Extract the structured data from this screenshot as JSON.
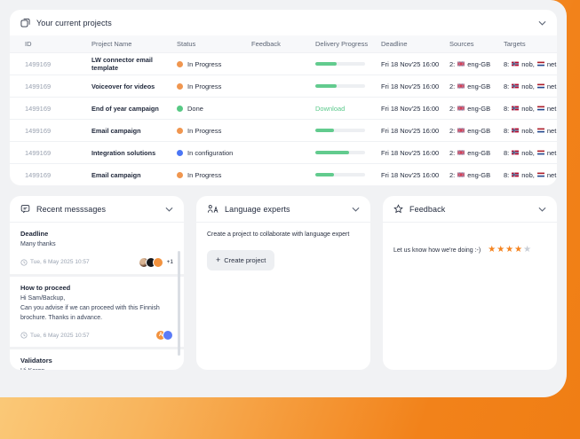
{
  "colors": {
    "accent_orange": "#F2821A",
    "status_in_progress": "#F0964F",
    "status_done": "#57C984",
    "status_in_configuration": "#4B76F5",
    "progress_fill": "#62CB8E",
    "download_link": "#5BC98B",
    "star_filled": "#F5831F",
    "star_empty": "#C9CED6"
  },
  "icons": {
    "projects-icon": "layered-squares",
    "messages-icon": "chat-bubble",
    "experts-icon": "person-with-letter-a",
    "feedback-icon": "star-outline",
    "chevron-down-icon": "chevron-down",
    "clock-icon": "clock-outline",
    "plus-icon": "+",
    "star-glyph": "★"
  },
  "projects": {
    "title": "Your current projects",
    "columns": [
      "ID",
      "Project Name",
      "Status",
      "Feedback",
      "Delivery Progress",
      "Deadline",
      "Sources",
      "Targets"
    ],
    "rows": [
      {
        "id": "1499169",
        "name": "LW connector email template",
        "status": "In Progress",
        "status_key": "status_in_progress",
        "delivery": {
          "type": "bar",
          "percent": 42
        },
        "deadline": "Fri 18 Nov'25 16:00",
        "sources": {
          "count": "2:",
          "langs": [
            {
              "flag": "gb",
              "code": "eng-GB"
            }
          ]
        },
        "targets": {
          "count": "8:",
          "langs": [
            {
              "flag": "no",
              "code": "nob,"
            },
            {
              "flag": "nl",
              "code": "net,"
            }
          ]
        }
      },
      {
        "id": "1499169",
        "name": "Voiceover for videos",
        "status": "In Progress",
        "status_key": "status_in_progress",
        "delivery": {
          "type": "bar",
          "percent": 42
        },
        "deadline": "Fri 18 Nov'25 16:00",
        "sources": {
          "count": "2:",
          "langs": [
            {
              "flag": "gb",
              "code": "eng-GB"
            }
          ]
        },
        "targets": {
          "count": "8:",
          "langs": [
            {
              "flag": "no",
              "code": "nob,"
            },
            {
              "flag": "nl",
              "code": "net,"
            }
          ]
        }
      },
      {
        "id": "1499169",
        "name": "End of year campaign",
        "status": "Done",
        "status_key": "status_done",
        "delivery": {
          "type": "download",
          "label": "Download"
        },
        "deadline": "Fri 18 Nov'25 16:00",
        "sources": {
          "count": "2:",
          "langs": [
            {
              "flag": "gb",
              "code": "eng-GB"
            }
          ]
        },
        "targets": {
          "count": "8:",
          "langs": [
            {
              "flag": "no",
              "code": "nob,"
            },
            {
              "flag": "nl",
              "code": "net,"
            }
          ]
        }
      },
      {
        "id": "1499169",
        "name": "Email campaign",
        "status": "In Progress",
        "status_key": "status_in_progress",
        "delivery": {
          "type": "bar",
          "percent": 38
        },
        "deadline": "Fri 18 Nov'25 16:00",
        "sources": {
          "count": "2:",
          "langs": [
            {
              "flag": "gb",
              "code": "eng-GB"
            }
          ]
        },
        "targets": {
          "count": "8:",
          "langs": [
            {
              "flag": "no",
              "code": "nob,"
            },
            {
              "flag": "nl",
              "code": "net,"
            }
          ]
        }
      },
      {
        "id": "1499169",
        "name": "Integration solutions",
        "status": "In configuration",
        "status_key": "status_in_configuration",
        "delivery": {
          "type": "bar",
          "percent": 68
        },
        "deadline": "Fri 18 Nov'25 16:00",
        "sources": {
          "count": "2:",
          "langs": [
            {
              "flag": "gb",
              "code": "eng-GB"
            }
          ]
        },
        "targets": {
          "count": "8:",
          "langs": [
            {
              "flag": "no",
              "code": "nob,"
            },
            {
              "flag": "nl",
              "code": "net,"
            }
          ]
        }
      },
      {
        "id": "1499169",
        "name": "Email campaign",
        "status": "In Progress",
        "status_key": "status_in_progress",
        "delivery": {
          "type": "bar",
          "percent": 38
        },
        "deadline": "Fri 18 Nov'25 16:00",
        "sources": {
          "count": "2:",
          "langs": [
            {
              "flag": "gb",
              "code": "eng-GB"
            }
          ]
        },
        "targets": {
          "count": "8:",
          "langs": [
            {
              "flag": "no",
              "code": "nob,"
            },
            {
              "flag": "nl",
              "code": "net,"
            }
          ]
        }
      }
    ]
  },
  "messages": {
    "title": "Recent messsages",
    "items": [
      {
        "title": "Deadline",
        "body": "Many thanks",
        "time": "Tue, 6 May 2025 10:57",
        "avatars": [
          {
            "type": "photo",
            "initial": ""
          },
          {
            "type": "dark",
            "initial": ""
          },
          {
            "type": "orange",
            "initial": ""
          }
        ],
        "extra": "+1"
      },
      {
        "title": "How to proceed",
        "body": "Hi Sam/Backup,\nCan you advise if we can proceed with this Finnish brochure. Thanks in advance.",
        "time": "Tue, 6 May 2025 10:57",
        "avatars": [
          {
            "type": "orange",
            "initial": "A"
          },
          {
            "type": "blue",
            "initial": ""
          }
        ],
        "extra": ""
      },
      {
        "title": "Validators",
        "body": "Hi Karen,",
        "time": "",
        "avatars": [],
        "extra": ""
      }
    ]
  },
  "experts": {
    "title": "Language experts",
    "description": "Create a project to collaborate with language expert",
    "button_plus": "+",
    "button_label": "Create project"
  },
  "feedback": {
    "title": "Feedback",
    "prompt": "Let us know how we're doing :-)",
    "stars_filled": 4,
    "stars_total": 5
  }
}
